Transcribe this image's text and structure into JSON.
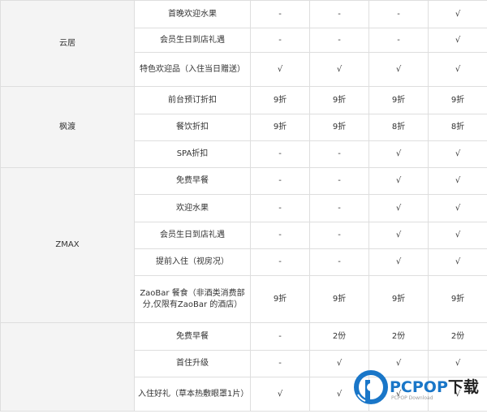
{
  "brands": {
    "yunju": "云居",
    "fengdu": "枫渡",
    "zmax": "ZMAX",
    "last": ""
  },
  "rows": [
    {
      "benefit": "首晚欢迎水果",
      "values": [
        "-",
        "-",
        "-",
        "√"
      ]
    },
    {
      "benefit": "会员生日到店礼遇",
      "values": [
        "-",
        "-",
        "-",
        "√"
      ]
    },
    {
      "benefit": "特色欢迎品（入住当日赠送）",
      "values": [
        "√",
        "√",
        "√",
        "√"
      ]
    },
    {
      "benefit": "前台预订折扣",
      "values": [
        "9折",
        "9折",
        "9折",
        "9折"
      ]
    },
    {
      "benefit": "餐饮折扣",
      "values": [
        "9折",
        "9折",
        "8折",
        "8折"
      ]
    },
    {
      "benefit": "SPA折扣",
      "values": [
        "-",
        "-",
        "√",
        "√"
      ]
    },
    {
      "benefit": "免费早餐",
      "values": [
        "-",
        "-",
        "√",
        "√"
      ]
    },
    {
      "benefit": "欢迎水果",
      "values": [
        "-",
        "-",
        "√",
        "√"
      ]
    },
    {
      "benefit": "会员生日到店礼遇",
      "values": [
        "-",
        "-",
        "√",
        "√"
      ]
    },
    {
      "benefit": "提前入住（视房况）",
      "values": [
        "-",
        "-",
        "√",
        "√"
      ]
    },
    {
      "benefit": "ZaoBar 餐食（非酒类消费部分,仅限有ZaoBar 的酒店）",
      "values": [
        "9折",
        "9折",
        "9折",
        "9折"
      ]
    },
    {
      "benefit": "免费早餐",
      "values": [
        "-",
        "2份",
        "2份",
        "2份"
      ]
    },
    {
      "benefit": "首住升级",
      "values": [
        "-",
        "√",
        "√",
        "√"
      ]
    },
    {
      "benefit": "入住好礼（草本热敷眼罩1片）",
      "values": [
        "√",
        "√",
        "√",
        "√"
      ]
    }
  ],
  "watermark": {
    "brand": "PCPOP",
    "suffix": "下载",
    "sub": "PCPOP Download",
    "color": "#1976c8"
  }
}
